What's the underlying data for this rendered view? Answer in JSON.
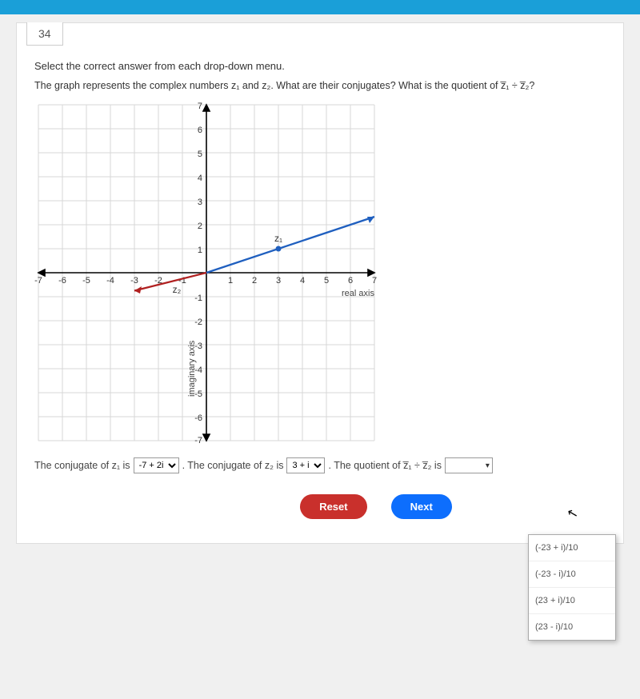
{
  "question_number": "34",
  "instruction": "Select the correct answer from each drop-down menu.",
  "question": "The graph represents the complex numbers z₁ and z₂. What are their conjugates? What is the quotient of z̅₁ ÷ z̅₂?",
  "graph": {
    "x_label": "real axis",
    "y_label": "imaginary axis",
    "x_ticks": [
      "-7",
      "-6",
      "-5",
      "-4",
      "-3",
      "-2",
      "-1",
      "1",
      "2",
      "3",
      "4",
      "5",
      "6",
      "7"
    ],
    "y_ticks": [
      "7",
      "6",
      "5",
      "4",
      "3",
      "2",
      "1",
      "-1",
      "-2",
      "-3",
      "-4",
      "-5",
      "-6",
      "-7"
    ],
    "points": {
      "z1_label": "z₁",
      "z2_label": "z₂"
    }
  },
  "answer": {
    "prefix1": "The conjugate of z₁ is",
    "select1": "-7 + 2i",
    "mid": ". The conjugate of z₂ is",
    "select2": "3 + i",
    "suffix": ". The quotient of z̅₁ ÷ z̅₂ is"
  },
  "dropdown_options": [
    "(-23 + i)/10",
    "(-23 - i)/10",
    "(23 + i)/10",
    "(23 - i)/10"
  ],
  "buttons": {
    "reset": "Reset",
    "next": "Next"
  },
  "chart_data": {
    "type": "scatter",
    "title": "",
    "xlabel": "real axis",
    "ylabel": "imaginary axis",
    "xlim": [
      -7,
      7
    ],
    "ylim": [
      -7,
      7
    ],
    "series": [
      {
        "name": "z1",
        "x": [
          3
        ],
        "y": [
          1
        ],
        "color": "#1f5fbf",
        "line_to_edge": true
      },
      {
        "name": "z2",
        "x": [
          -2
        ],
        "y": [
          -0.5
        ],
        "color": "#b02020",
        "line_to_edge": true
      }
    ]
  }
}
